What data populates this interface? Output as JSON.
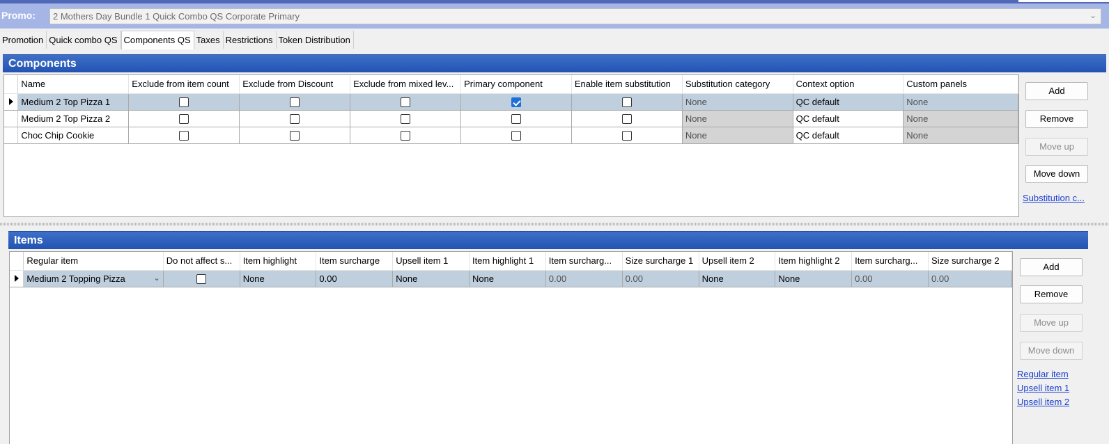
{
  "promo": {
    "label": "Promo:",
    "value": "2 Mothers Day Bundle 1 Quick Combo QS Corporate Primary"
  },
  "tabs": [
    {
      "label": "Promotion",
      "active": false
    },
    {
      "label": "Quick combo QS",
      "active": false
    },
    {
      "label": "Components QS",
      "active": true
    },
    {
      "label": "Taxes",
      "active": false
    },
    {
      "label": "Restrictions",
      "active": false
    },
    {
      "label": "Token Distribution",
      "active": false
    }
  ],
  "components": {
    "title": "Components",
    "columns": [
      "Name",
      "Exclude from item count",
      "Exclude from Discount",
      "Exclude from mixed lev...",
      "Primary component",
      "Enable item substitution",
      "Substitution category",
      "Context option",
      "Custom panels"
    ],
    "rows": [
      {
        "name": "Medium 2 Top Pizza 1",
        "exclude_count": false,
        "exclude_discount": false,
        "exclude_mixed": false,
        "primary": true,
        "enable_sub": false,
        "sub_category": "None",
        "context": "QC default",
        "custom_panels": "None",
        "selected": true
      },
      {
        "name": "Medium 2 Top Pizza 2",
        "exclude_count": false,
        "exclude_discount": false,
        "exclude_mixed": false,
        "primary": false,
        "enable_sub": false,
        "sub_category": "None",
        "context": "QC default",
        "custom_panels": "None",
        "selected": false
      },
      {
        "name": "Choc Chip Cookie",
        "exclude_count": false,
        "exclude_discount": false,
        "exclude_mixed": false,
        "primary": false,
        "enable_sub": false,
        "sub_category": "None",
        "context": "QC default",
        "custom_panels": "None",
        "selected": false
      }
    ],
    "buttons": {
      "add": "Add",
      "remove": "Remove",
      "move_up": "Move up",
      "move_down": "Move down"
    },
    "link": "Substitution c..."
  },
  "items": {
    "title": "Items",
    "columns": [
      "Regular item",
      "Do not affect s...",
      "Item highlight",
      "Item surcharge",
      "Upsell item 1",
      "Item highlight 1",
      "Item surcharg...",
      "Size surcharge 1",
      "Upsell item 2",
      "Item highlight 2",
      "Item surcharg...",
      "Size surcharge 2"
    ],
    "rows": [
      {
        "regular_item": "Medium 2 Topping Pizza",
        "do_not_affect": false,
        "item_highlight": "None",
        "item_surcharge": "0.00",
        "upsell_1": "None",
        "highlight_1": "None",
        "surcharge_1": "0.00",
        "size_surcharge_1": "0.00",
        "upsell_2": "None",
        "highlight_2": "None",
        "surcharge_2": "0.00",
        "size_surcharge_2": "0.00"
      }
    ],
    "buttons": {
      "add": "Add",
      "remove": "Remove",
      "move_up": "Move up",
      "move_down": "Move down"
    },
    "links": [
      "Regular item",
      "Upsell item 1",
      "Upsell item 2"
    ]
  }
}
